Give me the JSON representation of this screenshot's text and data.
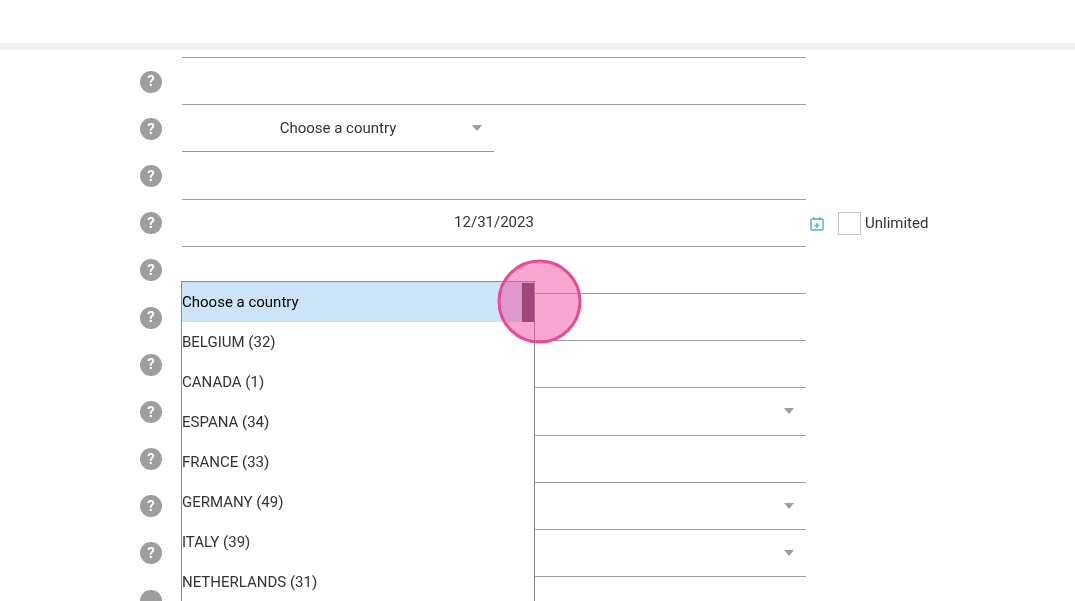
{
  "form_rows": [
    {
      "help": "?",
      "kind": "text"
    },
    {
      "help": "?",
      "kind": "country_select",
      "value": "Choose a country",
      "focused": true
    },
    {
      "help": "?",
      "kind": "text"
    },
    {
      "help": "?",
      "kind": "date",
      "value": "12/31/2023",
      "unlimited": {
        "label": "Unlimited",
        "checked": false
      }
    },
    {
      "help": "?",
      "kind": "text"
    },
    {
      "help": "?",
      "kind": "text"
    },
    {
      "help": "?",
      "kind": "text"
    },
    {
      "help": "?",
      "kind": "select"
    },
    {
      "help": "?",
      "kind": "text"
    },
    {
      "help": "?",
      "kind": "select"
    },
    {
      "help": "?",
      "kind": "select"
    },
    {
      "kind": "help_only"
    }
  ],
  "country_dropdown": {
    "options": [
      {
        "label": "Choose a country",
        "selected": true
      },
      {
        "label": "BELGIUM (32)",
        "selected": false
      },
      {
        "label": "CANADA (1)",
        "selected": false
      },
      {
        "label": "ESPANA (34)",
        "selected": false
      },
      {
        "label": "FRANCE (33)",
        "selected": false
      },
      {
        "label": "GERMANY (49)",
        "selected": false
      },
      {
        "label": "ITALY (39)",
        "selected": false
      },
      {
        "label": "NETHERLANDS (31)",
        "selected": false
      }
    ]
  }
}
